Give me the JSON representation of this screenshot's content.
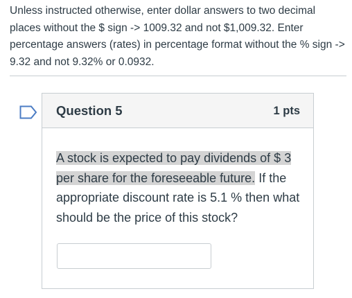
{
  "instructions": {
    "text": "Unless instructed otherwise, enter dollar answers to two decimal places without the $ sign -> 1009.32 and not $1,009.32.   Enter percentage answers (rates) in percentage format without the % sign -> 9.32 and not 9.32% or 0.0932."
  },
  "question": {
    "title": "Question 5",
    "points": "1 pts",
    "text_highlighted": "A stock is expected to pay dividends of $ 3 per share for the foreseeable future.",
    "text_rest": " If the appropriate discount rate is 5.1 % then what should be the price of this stock?",
    "answer_value": "",
    "answer_placeholder": ""
  },
  "colors": {
    "text": "#2d3b45",
    "border": "#c7cdd1",
    "header_bg": "#f5f5f5",
    "highlight": "#d4d4d4",
    "flag": "#4b7cc4"
  },
  "icons": {
    "flag": "bookmark-flag-icon"
  }
}
